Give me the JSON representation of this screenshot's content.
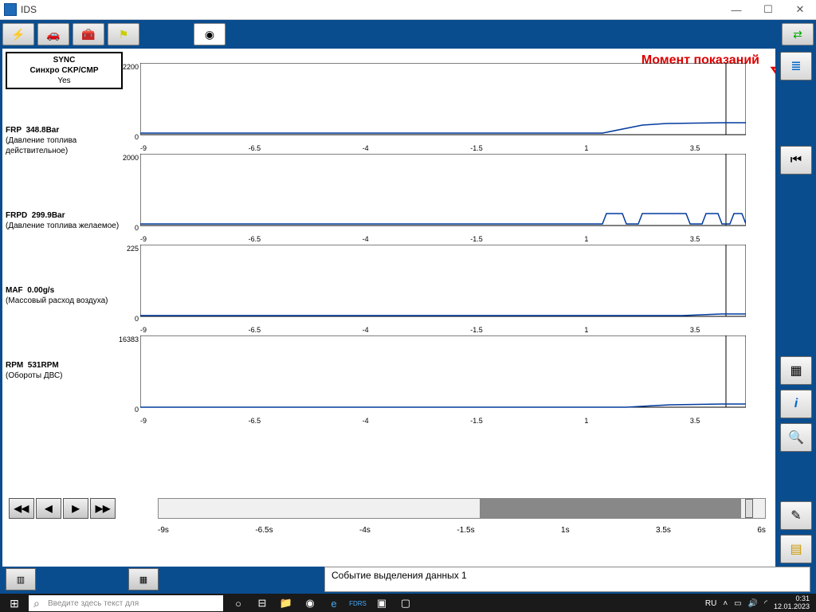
{
  "window": {
    "title": "IDS"
  },
  "annotation": "Момент показаний",
  "sync": {
    "l1": "SYNC",
    "l2": "Синхро CKP/CMP",
    "l3": "Yes"
  },
  "params": [
    {
      "name": "FRP",
      "value": "348.8Bar",
      "desc": "(Давление топлива действительное)",
      "ymax": "2200",
      "ymin": "0"
    },
    {
      "name": "FRPD",
      "value": "299.9Bar",
      "desc": "(Давление топлива желаемое)",
      "ymax": "2000",
      "ymin": "0"
    },
    {
      "name": "MAF",
      "value": "0.00g/s",
      "desc": "(Массовый расход воздуха)",
      "ymax": "225",
      "ymin": "0"
    },
    {
      "name": "RPM",
      "value": "531RPM",
      "desc": "(Обороты ДВС)",
      "ymax": "16383",
      "ymin": "0"
    }
  ],
  "xticks": [
    "-9",
    "-6.5",
    "-4",
    "-1.5",
    "1",
    "3.5",
    "6"
  ],
  "timelabels": [
    "-9s",
    "-6.5s",
    "-4s",
    "-1.5s",
    "1s",
    "3.5s",
    "6s"
  ],
  "status": "Событие выделения данных 1",
  "taskbar": {
    "search": "Введите здесь текст для",
    "lang": "RU",
    "time": "0:31",
    "date": "12.01.2023"
  },
  "chart_data": [
    {
      "type": "line",
      "title": "FRP",
      "ylabel": "Bar",
      "xlabel": "s",
      "ylim": [
        0,
        2200
      ],
      "xlim": [
        -9,
        6
      ],
      "x": [
        -9,
        2.5,
        3.5,
        4,
        5,
        5.8,
        6
      ],
      "y": [
        30,
        30,
        200,
        260,
        280,
        290,
        290
      ]
    },
    {
      "type": "line",
      "title": "FRPD",
      "ylabel": "Bar",
      "xlabel": "s",
      "ylim": [
        0,
        2000
      ],
      "xlim": [
        -9,
        6
      ],
      "x": [
        -9,
        2.5,
        2.6,
        3.0,
        3.1,
        3.4,
        3.5,
        4.6,
        4.7,
        5.0,
        5.1,
        5.4,
        5.5,
        5.8,
        5.9,
        6
      ],
      "y": [
        30,
        30,
        300,
        300,
        30,
        30,
        300,
        300,
        30,
        30,
        300,
        300,
        30,
        30,
        300,
        30
      ]
    },
    {
      "type": "line",
      "title": "MAF",
      "ylabel": "g/s",
      "xlabel": "s",
      "ylim": [
        0,
        225
      ],
      "xlim": [
        -9,
        6
      ],
      "x": [
        -9,
        4.5,
        5.5,
        6
      ],
      "y": [
        2,
        2,
        6,
        6
      ]
    },
    {
      "type": "line",
      "title": "RPM",
      "ylabel": "RPM",
      "xlabel": "s",
      "ylim": [
        0,
        16383
      ],
      "xlim": [
        -9,
        6
      ],
      "x": [
        -9,
        3.0,
        3.8,
        4.2,
        5.5,
        6
      ],
      "y": [
        0,
        0,
        450,
        500,
        560,
        560
      ]
    }
  ]
}
